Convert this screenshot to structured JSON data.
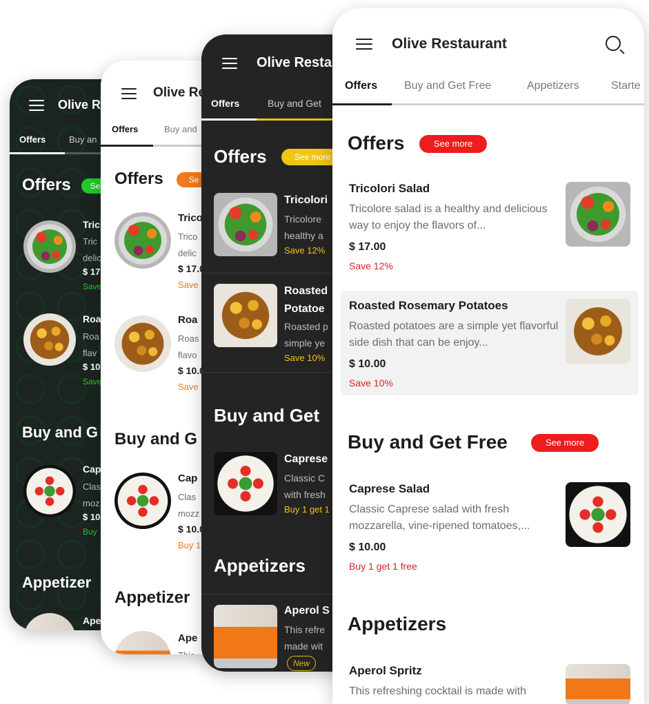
{
  "app": {
    "title": "Olive Restaurant"
  },
  "tabs": [
    "Offers",
    "Buy and Get Free",
    "Appetizers",
    "Starters"
  ],
  "sections": {
    "offers": {
      "title": "Offers",
      "see_more": "See more"
    },
    "buy_get_free": {
      "title": "Buy and Get Free",
      "see_more": "See more"
    },
    "appetizers": {
      "title": "Appetizers"
    }
  },
  "items": [
    {
      "name": "Tricolori Salad",
      "description": "Tricolore salad is a healthy and delicious way to enjoy the flavors of...",
      "price": "$ 17.00",
      "promo": "Save 12%",
      "image": "salad-image"
    },
    {
      "name": "Roasted Rosemary Potatoes",
      "description": "Roasted potatoes are a simple yet flavorful side dish that can be enjoy...",
      "price": "$ 10.00",
      "promo": "Save 10%",
      "image": "potato-image"
    },
    {
      "name": "Caprese Salad",
      "description": "Classic Caprese salad with fresh mozzarella, vine-ripened tomatoes,...",
      "price": "$ 10.00",
      "promo": "Buy 1 get 1 free",
      "image": "caprese-image"
    },
    {
      "name": "Aperol Spritz",
      "description": "This refreshing cocktail is made with",
      "badge": "New",
      "image": "aperol-image"
    }
  ],
  "phone_themes": {
    "green": {
      "accent": "#1ecb2a",
      "background": "#1b2420"
    },
    "orange": {
      "accent": "#f07a1c",
      "background": "#ffffff"
    },
    "yellow": {
      "accent": "#f2c417",
      "background": "#242424"
    },
    "red": {
      "accent": "#ee1c1c",
      "background": "#ffffff"
    }
  },
  "truncated": {
    "p1_title": "Olive R",
    "p1_tab2": "Buy an",
    "p1_sect2": "Buy and G",
    "p1_sect3": "Appetizer",
    "p1_see": "Se",
    "p1_n1": "Tric",
    "p1_d1": "Tric\ndelic",
    "p1_pr1": "$ 17",
    "p1_pm1": "Save",
    "p1_n2": "Roa",
    "p1_d2": "Roa\nflav",
    "p1_pr2": "$ 10",
    "p1_pm2": "Save",
    "p1_n3": "Cap",
    "p1_d3": "Clas\nmoz",
    "p1_pr3": "$ 10",
    "p1_pm3": "Buy",
    "p1_n4": "Ape",
    "p2_title": "Olive Re",
    "p2_tab2": "Buy and",
    "p2_sect2": "Buy and G",
    "p2_sect3": "Appetizer",
    "p2_see": "Se",
    "p2_n1": "Trico",
    "p2_d1": "Trico\ndelic",
    "p2_pr1": "$ 17.0",
    "p2_pm1": "Save",
    "p2_n2": "Roa",
    "p2_d2": "Roas\nflavo",
    "p2_pr2": "$ 10.0",
    "p2_pm2": "Save",
    "p2_n3": "Cap",
    "p2_d3": "Clas\nmozz",
    "p2_pr3": "$ 10.0",
    "p2_pm3": "Buy 1",
    "p2_n4": "Ape",
    "p2_d4": "This",
    "p3_title": "Olive Resta",
    "p3_tab2": "Buy and Get",
    "p3_sect2": "Buy and Get",
    "p3_see": "See more",
    "p3_n1": "Tricolori",
    "p3_d1": "Tricolore\nhealthy a",
    "p3_pm1": "Save 12%",
    "p3_n2": "Roasted\nPotatoe",
    "p3_d2": "Roasted p\nsimple ye",
    "p3_pm2": "Save 10%",
    "p3_n3": "Caprese",
    "p3_d3": "Classic C\nwith fresh",
    "p3_pm3": "Buy 1 get 1",
    "p3_n4": "Aperol S",
    "p3_d4": "This refre\nmade wit",
    "p4_tab4": "Starte",
    "p4_d4": "This refreshing cocktail is made with"
  }
}
